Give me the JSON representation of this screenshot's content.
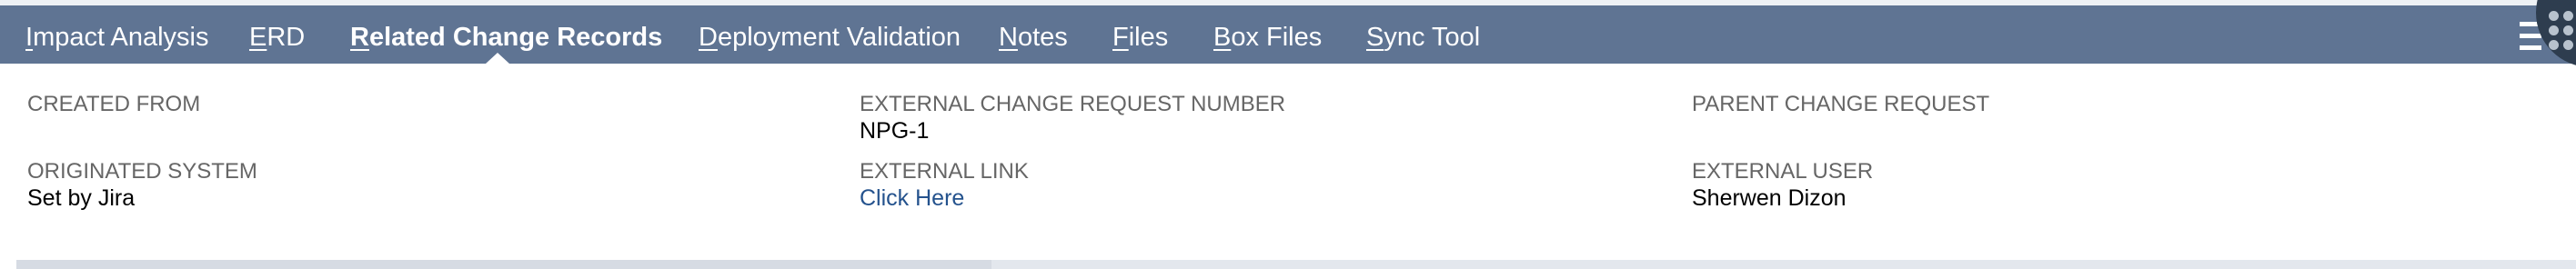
{
  "tabs": [
    {
      "access_key": "I",
      "rest": "mpact Analysis",
      "active": false
    },
    {
      "access_key": "E",
      "rest": "RD",
      "active": false
    },
    {
      "access_key": "R",
      "rest": "elated Change Records",
      "active": true
    },
    {
      "access_key": "D",
      "rest": "eployment Validation",
      "active": false
    },
    {
      "access_key": "N",
      "rest": "otes",
      "active": false
    },
    {
      "access_key": "F",
      "rest": "iles",
      "active": false
    },
    {
      "access_key": "B",
      "rest": "ox Files",
      "active": false
    },
    {
      "access_key": "S",
      "rest": "ync Tool",
      "active": false
    }
  ],
  "fields": {
    "created_from": {
      "label": "CREATED FROM",
      "value": ""
    },
    "external_change_request_number": {
      "label": "EXTERNAL CHANGE REQUEST NUMBER",
      "value": "NPG-1"
    },
    "parent_change_request": {
      "label": "PARENT CHANGE REQUEST",
      "value": ""
    },
    "originated_system": {
      "label": "ORIGINATED SYSTEM",
      "value": "Set by Jira"
    },
    "external_link": {
      "label": "EXTERNAL LINK",
      "value": "Click Here"
    },
    "external_user": {
      "label": "EXTERNAL USER",
      "value": "Sherwen Dizon"
    }
  },
  "icons": {
    "menu": "hamburger-menu-icon",
    "launcher": "apps-grid-icon"
  },
  "colors": {
    "tab_bar": "#5f7493",
    "label": "#666666",
    "link": "#24528d"
  }
}
